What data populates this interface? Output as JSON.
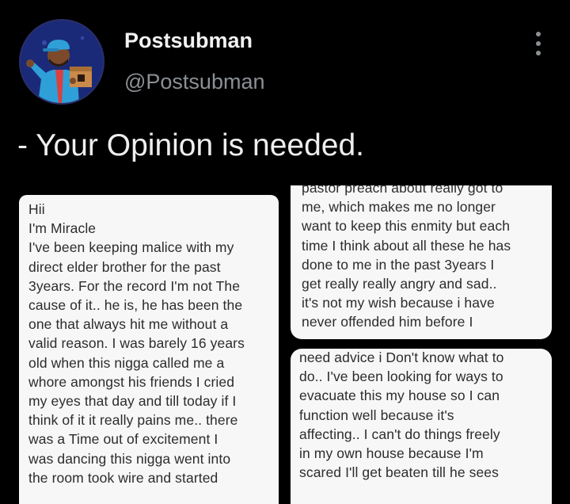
{
  "profile": {
    "display_name": "Postsubman",
    "handle": "@Postsubman",
    "avatar_icon": "delivery-man-avatar",
    "avatar_bg": "#1b2a78"
  },
  "more_icon": "more-vertical-icon",
  "tweet": {
    "text": "- Your Opinion is needed."
  },
  "screenshots": {
    "left": {
      "lines": [
        "Hii",
        "I'm Miracle",
        "I've been keeping malice with my",
        "direct elder brother for the past",
        "3years. For the record I'm not The",
        "cause of it.. he is, he has been the",
        "one that always hit me without a",
        "valid reason. I was barely 16 years",
        "old when this nigga called me a",
        "whore amongst his friends I cried",
        "my eyes that day and till today if I",
        "think of it it really pains me.. there",
        "was a Time out of excitement I",
        "was dancing this nigga went into",
        "the room took wire and started"
      ]
    },
    "right_top": {
      "lines": [
        "pastor preach about really got to",
        "me, which makes me no longer",
        "want to keep this enmity but each",
        "time I think about all these he has",
        "done to me in the past 3years I",
        "get really really angry and sad..",
        "it's not my wish because i have",
        "never offended him before I"
      ]
    },
    "right_bottom": {
      "lines": [
        "need advice i Don't know what to",
        "do.. I've been looking for ways to",
        "evacuate this my house so I can",
        "function well because it's",
        "affecting.. I can't do things freely",
        "in my own house because I'm",
        "scared I'll get beaten till he sees"
      ]
    }
  }
}
